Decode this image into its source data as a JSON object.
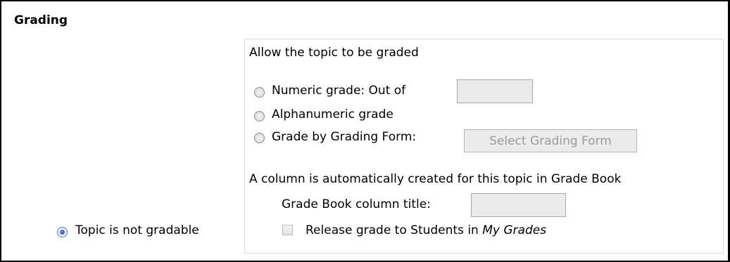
{
  "section": {
    "title": "Grading"
  },
  "not_gradable": {
    "label": "Topic is not gradable",
    "selected": true
  },
  "panel": {
    "heading": "Allow the topic to be graded",
    "options": {
      "numeric": {
        "label": "Numeric grade: Out of",
        "value": ""
      },
      "alphanumeric": {
        "label": "Alphanumeric grade"
      },
      "grading_form": {
        "label": "Grade by Grading Form:",
        "button_label": "Select Grading Form"
      }
    },
    "gradebook_note": "A column is automatically created for this topic in Grade Book",
    "column_title": {
      "label": "Grade Book column title:",
      "value": ""
    },
    "release": {
      "label_prefix": "Release grade to Students in ",
      "label_emphasis": "My Grades",
      "checked": false
    }
  }
}
